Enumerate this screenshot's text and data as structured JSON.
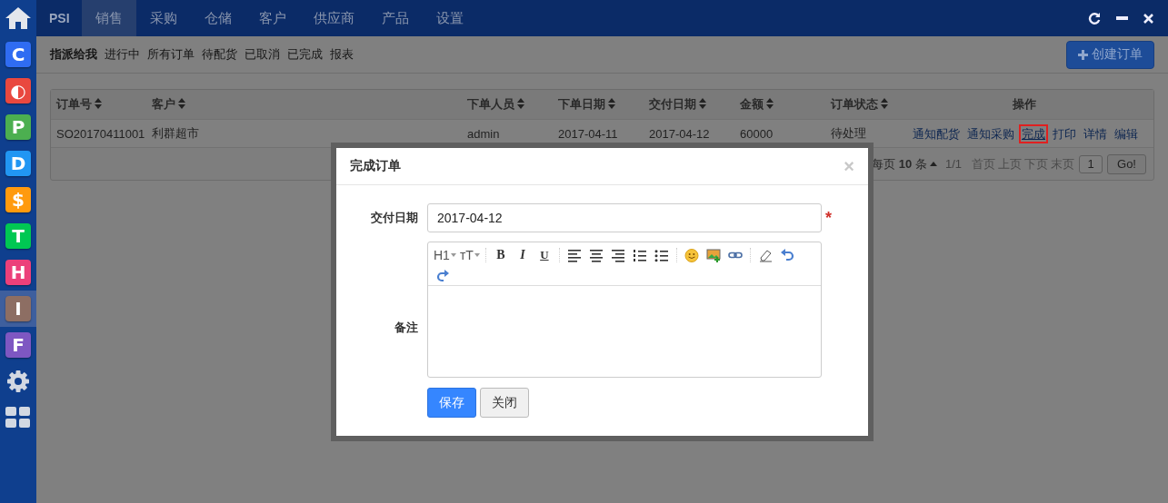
{
  "top_bar": {
    "brand": "PSI",
    "tabs": [
      {
        "label": "销售",
        "selected": true
      },
      {
        "label": "采购",
        "selected": false
      },
      {
        "label": "仓储",
        "selected": false
      },
      {
        "label": "客户",
        "selected": false
      },
      {
        "label": "供应商",
        "selected": false
      },
      {
        "label": "产品",
        "selected": false
      },
      {
        "label": "设置",
        "selected": false
      }
    ]
  },
  "sidebar": {
    "apps": [
      {
        "glyph": "C",
        "color": "#2f6cf2",
        "selected": false
      },
      {
        "glyph": "◐",
        "color": "#e9483f",
        "selected": false
      },
      {
        "glyph": "P",
        "color": "#4caf50",
        "selected": false
      },
      {
        "glyph": "D",
        "color": "#2196f3",
        "selected": false
      },
      {
        "glyph": "$",
        "color": "#ff9a0e",
        "selected": false
      },
      {
        "glyph": "T",
        "color": "#00c853",
        "selected": false
      },
      {
        "glyph": "H",
        "color": "#ec407a",
        "selected": false
      },
      {
        "glyph": "I",
        "color": "#8d6e63",
        "selected": true
      },
      {
        "glyph": "F",
        "color": "#7e57c2",
        "selected": false
      }
    ]
  },
  "sub_nav": [
    {
      "label": "指派给我",
      "selected": true
    },
    {
      "label": "进行中",
      "selected": false
    },
    {
      "label": "所有订单",
      "selected": false
    },
    {
      "label": "待配货",
      "selected": false
    },
    {
      "label": "已取消",
      "selected": false
    },
    {
      "label": "已完成",
      "selected": false
    },
    {
      "label": "报表",
      "selected": false
    }
  ],
  "create_button": "创建订单",
  "table": {
    "columns": [
      {
        "label": "订单号",
        "sortable": true
      },
      {
        "label": "客户",
        "sortable": true
      },
      {
        "label": "下单人员",
        "sortable": true
      },
      {
        "label": "下单日期",
        "sortable": true
      },
      {
        "label": "交付日期",
        "sortable": true
      },
      {
        "label": "金额",
        "sortable": true
      },
      {
        "label": "订单状态",
        "sortable": true
      },
      {
        "label": "操作",
        "sortable": false
      }
    ],
    "rows": [
      {
        "cells": [
          "SO20170411001",
          "利群超市",
          "admin",
          "2017-04-11",
          "2017-04-12",
          "60000",
          "待处理"
        ],
        "actions": [
          {
            "label": "通知配货",
            "highlighted": false
          },
          {
            "label": "通知采购",
            "highlighted": false
          },
          {
            "label": "完成",
            "highlighted": true
          },
          {
            "label": "打印",
            "highlighted": false
          },
          {
            "label": "详情",
            "highlighted": false
          },
          {
            "label": "编辑",
            "highlighted": false
          }
        ]
      }
    ]
  },
  "pagination": {
    "page_size": "每页 **10** 条",
    "page_count": "1/1",
    "links": [
      "首页",
      "上页",
      "下页",
      "末页"
    ],
    "page_input": "1",
    "go": "Go!"
  },
  "dialog": {
    "title": "完成订单",
    "close": "×",
    "date_label": "交付日期",
    "date_value": "2017-04-12",
    "required_mark": "*",
    "note_label": "备注",
    "toolbar_text": [
      {
        "label": "H1",
        "kind": "dropdown"
      },
      {
        "label": "ᴛT",
        "kind": "dropdown"
      },
      {
        "label": "B",
        "kind": "bold"
      },
      {
        "label": "I",
        "kind": "italic"
      },
      {
        "label": "U",
        "kind": "underline"
      }
    ],
    "buttons": [
      {
        "label": "保存",
        "kind": "primary"
      },
      {
        "label": "关闭",
        "kind": "default"
      }
    ]
  }
}
